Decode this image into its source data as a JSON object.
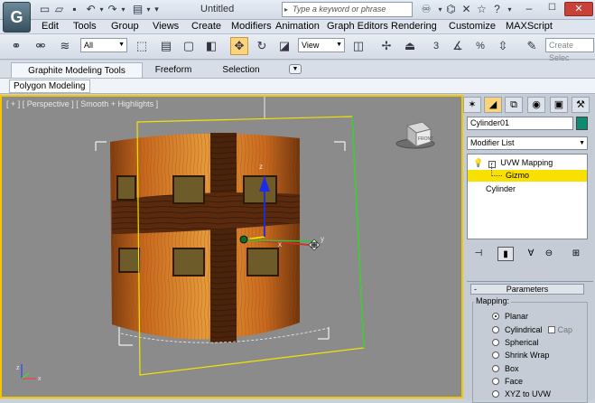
{
  "window": {
    "title": "Untitled"
  },
  "search": {
    "placeholder": "Type a keyword or phrase"
  },
  "menubar": {
    "items": [
      "Edit",
      "Tools",
      "Group",
      "Views",
      "Create",
      "Modifiers",
      "Animation",
      "Graph Editors",
      "Rendering",
      "Customize",
      "MAXScript"
    ]
  },
  "toolbar": {
    "selection_filter": "All",
    "ref_coord": "View",
    "named_selection_placeholder": "Create Selec",
    "snap_value": "3",
    "percent_label": "%"
  },
  "ribbon": {
    "tabs": [
      "Graphite Modeling Tools",
      "Freeform",
      "Selection"
    ],
    "panel": "Polygon Modeling"
  },
  "viewport": {
    "label": "[ + ] [ Perspective ] [ Smooth + Highlights ]",
    "viewcube_face": "FRONT",
    "axes": {
      "x": "x",
      "y": "y",
      "z": "z"
    }
  },
  "command_panel": {
    "object_name": "Cylinder01",
    "object_color": "#0e8c72",
    "modifier_list": "Modifier List",
    "stack": {
      "modifier": "UVW Mapping",
      "sub": "Gizmo",
      "base": "Cylinder"
    },
    "rollout_title": "Parameters",
    "mapping_group": "Mapping:",
    "mapping_options": [
      "Planar",
      "Cylindrical",
      "Spherical",
      "Shrink Wrap",
      "Box",
      "Face",
      "XYZ to UVW"
    ],
    "mapping_selected": "Planar",
    "cap_label": "Cap"
  },
  "colors": {
    "accent": "#f2c600",
    "selection": "#fbd37b",
    "viewport_bg": "#8b8b8b"
  }
}
